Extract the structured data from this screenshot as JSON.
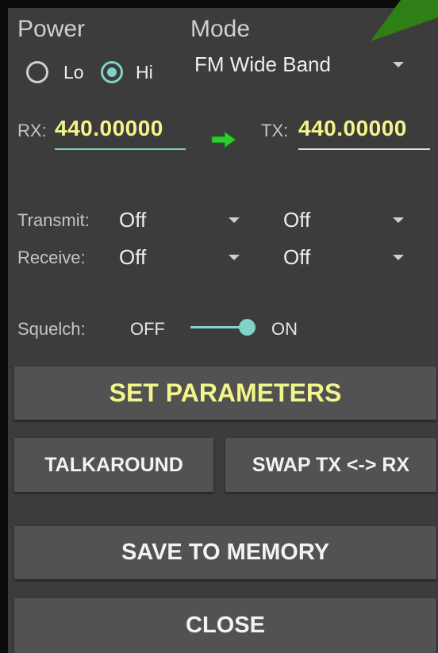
{
  "power": {
    "label": "Power",
    "options": [
      {
        "label": "Lo",
        "selected": false
      },
      {
        "label": "Hi",
        "selected": true
      }
    ]
  },
  "mode": {
    "label": "Mode",
    "value": "FM Wide Band"
  },
  "rx": {
    "label": "RX:",
    "value": "440.00000"
  },
  "tx": {
    "label": "TX:",
    "value": "440.00000"
  },
  "transmit": {
    "label": "Transmit:",
    "tone_a": "Off",
    "tone_b": "Off"
  },
  "receive": {
    "label": "Receive:",
    "tone_a": "Off",
    "tone_b": "Off"
  },
  "squelch": {
    "label": "Squelch:",
    "off_label": "OFF",
    "on_label": "ON",
    "state": "on"
  },
  "buttons": {
    "set_parameters": "SET PARAMETERS",
    "talkaround": "TALKAROUND",
    "swap": "SWAP TX <-> RX",
    "save": "SAVE TO MEMORY",
    "close": "CLOSE"
  },
  "colors": {
    "accent": "#7fd3c8",
    "frequency": "#f2f58a",
    "background": "#3c3c3c",
    "button": "#525252",
    "arrow": "#2ecc2e"
  }
}
